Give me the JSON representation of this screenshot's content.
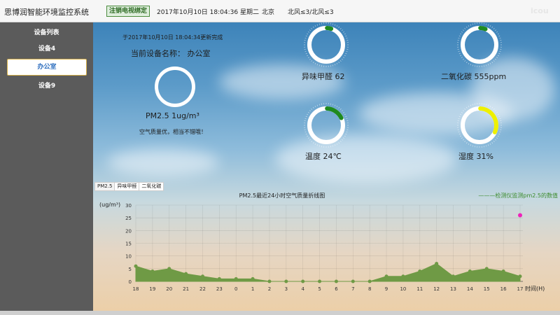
{
  "header": {
    "app_title": "思博润智能环境监控系统",
    "unbind_button": "注销电视绑定",
    "datetime": "2017年10月10日 18:04:36 星期二",
    "city": "北京",
    "wind": "北风≤3/北风≤3",
    "logo_text": "icou"
  },
  "sidebar": {
    "title": "设备列表",
    "items": [
      {
        "label": "设备4",
        "active": false
      },
      {
        "label": "办公室",
        "active": true
      },
      {
        "label": "设备9",
        "active": false
      }
    ]
  },
  "status": {
    "update_time": "于2017年10月10日 18:04:34更新完成",
    "device_name": "当前设备名称： 办公室",
    "pm25": "PM2.5   1ug/m³",
    "quality_msg": "空气质量优，相当不错哦！"
  },
  "gauges": [
    {
      "id": "formaldehyde",
      "label": "异味甲醛   62",
      "level": 0.04,
      "color": "#1f8a1f"
    },
    {
      "id": "co2",
      "label": "二氧化碳   555ppm",
      "level": 0.05,
      "color": "#1f8a1f"
    },
    {
      "id": "temperature",
      "label": "温度   24℃",
      "level": 0.17,
      "color": "#1f8a1f"
    },
    {
      "id": "humidity",
      "label": "湿度   31%",
      "level": 0.31,
      "color": "#eef000"
    }
  ],
  "tabs": [
    {
      "label": "PM2.5",
      "active": true
    },
    {
      "label": "异味甲醛",
      "active": false
    },
    {
      "label": "二氧化碳",
      "active": false
    }
  ],
  "chart_data": {
    "type": "area",
    "title": "PM2.5最近24小时空气质量折线图",
    "legend": "———检测仪监测pm2.5的数值",
    "xlabel": "时间(H)",
    "ylabel": "(ug/m³)",
    "categories": [
      "18",
      "19",
      "20",
      "21",
      "22",
      "23",
      "0",
      "1",
      "2",
      "3",
      "4",
      "5",
      "6",
      "7",
      "8",
      "9",
      "10",
      "11",
      "12",
      "13",
      "14",
      "15",
      "16",
      "17"
    ],
    "values": [
      6,
      4,
      5,
      3,
      2,
      1,
      1,
      1,
      0,
      0,
      0,
      0,
      0,
      0,
      0,
      2,
      2,
      4,
      7,
      2,
      4,
      5,
      4,
      2
    ],
    "current_point": {
      "x": "17",
      "y": 26
    },
    "ylim": [
      0,
      30
    ],
    "yticks": [
      0,
      5,
      10,
      15,
      20,
      25,
      30
    ],
    "grid": true,
    "colors": {
      "area": "#6f9a45",
      "point": "#ee22bb"
    }
  }
}
